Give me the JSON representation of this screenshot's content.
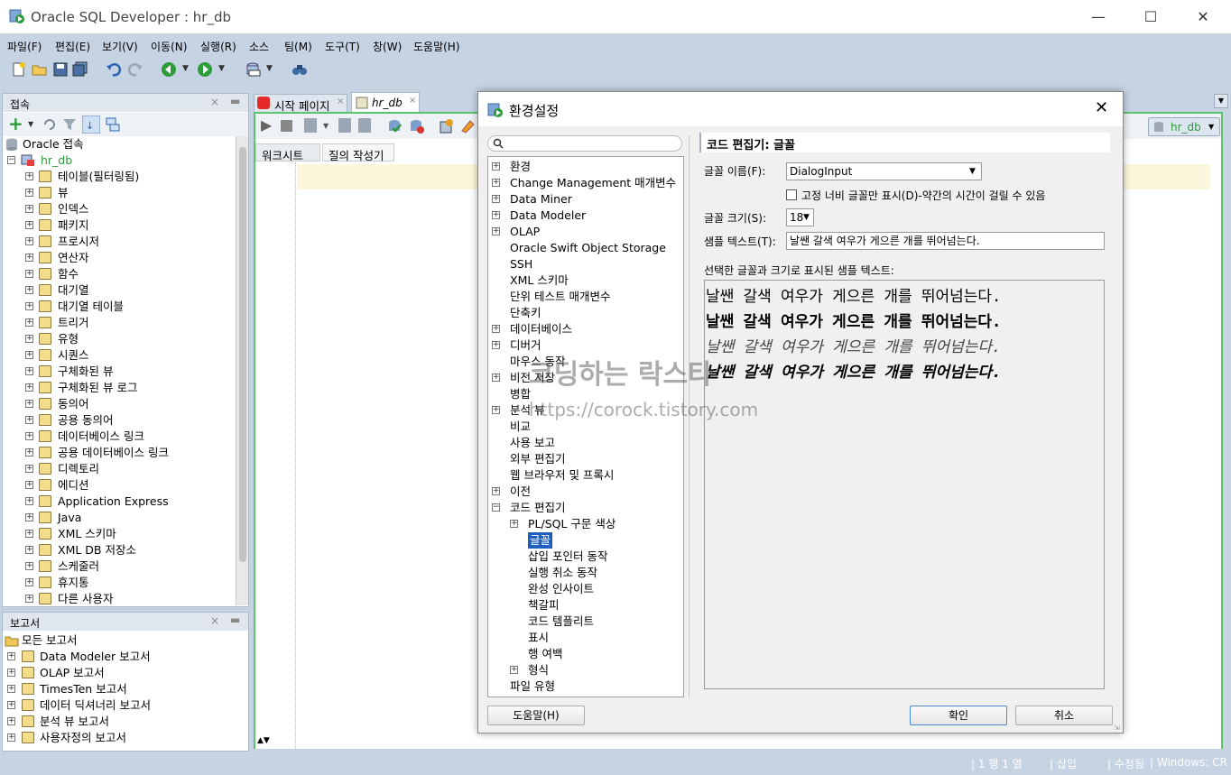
{
  "window": {
    "title": "Oracle SQL Developer : hr_db"
  },
  "menu": [
    "파일(F)",
    "편집(E)",
    "보기(V)",
    "이동(N)",
    "실행(R)",
    "소스",
    "팀(M)",
    "도구(T)",
    "창(W)",
    "도움말(H)"
  ],
  "connections_panel": {
    "title": "접속",
    "root": "Oracle 접속",
    "db": "hr_db",
    "items": [
      "테이블(필터링됨)",
      "뷰",
      "인덱스",
      "패키지",
      "프로시저",
      "연산자",
      "함수",
      "대기열",
      "대기열 테이블",
      "트리거",
      "유형",
      "시퀀스",
      "구체화된 뷰",
      "구체화된 뷰 로그",
      "동의어",
      "공용 동의어",
      "데이터베이스 링크",
      "공용 데이터베이스 링크",
      "디렉토리",
      "에디션",
      "Application Express",
      "Java",
      "XML 스키마",
      "XML DB 저장소",
      "스케줄러",
      "휴지통",
      "다른 사용자"
    ]
  },
  "reports_panel": {
    "title": "보고서",
    "root": "모든 보고서",
    "items": [
      "Data Modeler 보고서",
      "OLAP 보고서",
      "TimesTen 보고서",
      "데이터 딕셔너리 보고서",
      "분석 뷰 보고서",
      "사용자정의 보고서"
    ]
  },
  "editor": {
    "tabs": [
      "시작 페이지",
      "hr_db"
    ],
    "subtabs": [
      "워크시트",
      "질의 작성기"
    ],
    "connection": "hr_db"
  },
  "dialog": {
    "title": "환경설정",
    "search_placeholder": "",
    "tree": [
      "환경",
      "Change Management 매개변수",
      "Data Miner",
      "Data Modeler",
      "OLAP",
      "Oracle Swift Object Storage",
      "SSH",
      "XML 스키마",
      "단위 테스트 매개변수",
      "단축키",
      "데이터베이스",
      "디버거",
      "마우스 동작",
      "비전 저장",
      "병합",
      "분석 뷰",
      "비교",
      "사용 보고",
      "외부 편집기",
      "웹 브라우저 및 프록시",
      "이전",
      "코드 편집기"
    ],
    "tree_children": [
      "PL/SQL 구문 색상",
      "글꼴",
      "삽입 포인터 동작",
      "실행 취소 동작",
      "완성 인사이트",
      "책갈피",
      "코드 템플리트",
      "표시",
      "행 여백",
      "형식"
    ],
    "tree_last": "파일 유형",
    "section_title": "코드 편집기: 글꼴",
    "font_name_label": "글꼴 이름(F):",
    "font_name_value": "DialogInput",
    "fixed_width_label": "고정 너비 글꼴만 표시(D)-약간의 시간이 걸릴 수 있음",
    "font_size_label": "글꼴 크기(S):",
    "font_size_value": "18",
    "sample_text_label": "샘플 텍스트(T):",
    "sample_text_value": "날쌘 갈색 여우가 게으른 개를 뛰어넘는다.",
    "preview_label": "선택한 글꼴과 크기로 표시된 샘플 텍스트:",
    "preview_lines": [
      "날쌘 갈색 여우가 게으른 개를 뛰어넘는다.",
      "날쌘 갈색 여우가 게으른 개를 뛰어넘는다.",
      "날쌘 갈색 여우가 게으른 개를 뛰어넘는다.",
      "날쌘 갈색 여우가 게으른 개를 뛰어넘는다."
    ],
    "help_button": "도움말(H)",
    "ok_button": "확인",
    "cancel_button": "취소"
  },
  "watermark": {
    "line1": "코딩하는 락스타",
    "line2": "https://corock.tistory.com"
  },
  "status": {
    "pos": "1 행 1 열",
    "mode": "삽입",
    "modified": "수정됨",
    "os": "Windows: CR"
  }
}
